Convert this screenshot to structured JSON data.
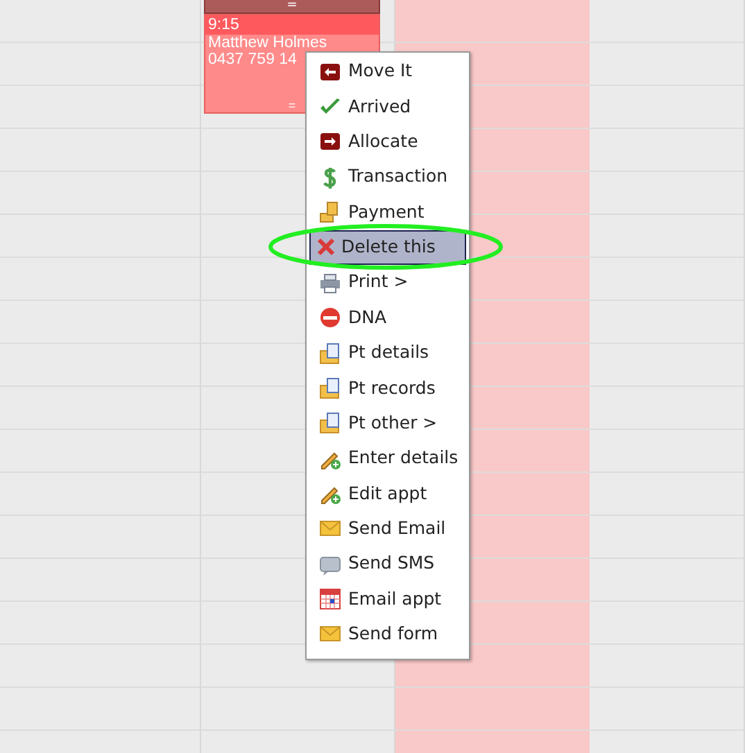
{
  "appointment": {
    "top_handle": "=",
    "time": "9:15",
    "patient": "Matthew Holmes",
    "phone": "0437 759 14",
    "bottom_handle": "="
  },
  "context_menu": {
    "items": [
      {
        "label": "Move It",
        "selected": false
      },
      {
        "label": "Arrived",
        "selected": false
      },
      {
        "label": "Allocate",
        "selected": false
      },
      {
        "label": "Transaction",
        "selected": false
      },
      {
        "label": "Payment",
        "selected": false
      },
      {
        "label": "Delete this",
        "selected": true
      },
      {
        "label": "Print >",
        "selected": false
      },
      {
        "label": "DNA",
        "selected": false
      },
      {
        "label": "Pt details",
        "selected": false
      },
      {
        "label": "Pt records",
        "selected": false
      },
      {
        "label": "Pt other >",
        "selected": false
      },
      {
        "label": "Enter details",
        "selected": false
      },
      {
        "label": "Edit appt",
        "selected": false
      },
      {
        "label": "Send Email",
        "selected": false
      },
      {
        "label": "Send SMS",
        "selected": false
      },
      {
        "label": "Email appt",
        "selected": false
      },
      {
        "label": "Send form",
        "selected": false
      }
    ]
  }
}
